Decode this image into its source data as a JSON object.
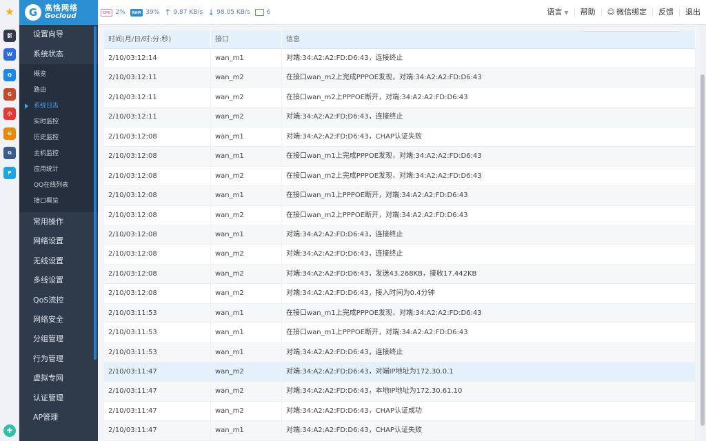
{
  "favorites": [
    {
      "name": "star",
      "color": "#f5b400",
      "label": "★"
    },
    {
      "name": "news",
      "color": "#333a48",
      "label": "新"
    },
    {
      "name": "doc",
      "color": "#2d6cdf",
      "label": "W"
    },
    {
      "name": "chat",
      "color": "#1e88e5",
      "label": "Q"
    },
    {
      "name": "game1",
      "color": "#c34a2c",
      "label": "G"
    },
    {
      "name": "red-app",
      "color": "#e53935",
      "label": "小"
    },
    {
      "name": "game2",
      "color": "#e8890c",
      "label": "G"
    },
    {
      "name": "game3",
      "color": "#3b5b8c",
      "label": "G"
    },
    {
      "name": "p-app",
      "color": "#1ca7e0",
      "label": "P"
    }
  ],
  "brand": {
    "name_cn": "高恪网络",
    "name_en": "Gocloud",
    "mark": "G"
  },
  "stats": {
    "cpu_chip": "CPU",
    "cpu": "2%",
    "ram_chip": "RAM",
    "ram": "39%",
    "upload": "9.87 KB/s",
    "download": "98.05 KB/s",
    "devices": "6"
  },
  "topmenu": {
    "language": "语言",
    "help": "帮助",
    "wechat": "微信绑定",
    "feedback": "反馈",
    "logout": "退出"
  },
  "sidebar": {
    "top": [
      "设置向导",
      "系统状态"
    ],
    "sub": [
      "概览",
      "路由",
      "系统日志",
      "实时监控",
      "历史监控",
      "主机监控",
      "应用统计",
      "QQ在线列表",
      "接口概览"
    ],
    "active_sub": 2,
    "nav": [
      "常用操作",
      "网络设置",
      "无线设置",
      "多线设置",
      "QoS流控",
      "网络安全",
      "分组管理",
      "行为管理",
      "虚拟专网",
      "认证管理",
      "AP管理"
    ]
  },
  "table": {
    "headers": [
      "时间(月/日/时:分:秒)",
      "接口",
      "信息"
    ],
    "rows": [
      [
        "2/10/03:12:14",
        "wan_m1",
        "对端:34:A2:A2:FD:D6:43，连接终止"
      ],
      [
        "2/10/03:12:11",
        "wan_m2",
        "在接口wan_m2上完成PPPOE发现，对端:34:A2:A2:FD:D6:43"
      ],
      [
        "2/10/03:12:11",
        "wan_m2",
        "在接口wan_m2上PPPOE断开，对端:34:A2:A2:FD:D6:43"
      ],
      [
        "2/10/03:12:11",
        "wan_m2",
        "对端:34:A2:A2:FD:D6:43，连接终止"
      ],
      [
        "2/10/03:12:08",
        "wan_m1",
        "对端:34:A2:A2:FD:D6:43，CHAP认证失败"
      ],
      [
        "2/10/03:12:08",
        "wan_m1",
        "在接口wan_m1上完成PPPOE发现，对端:34:A2:A2:FD:D6:43"
      ],
      [
        "2/10/03:12:08",
        "wan_m2",
        "在接口wan_m2上完成PPPOE发现，对端:34:A2:A2:FD:D6:43"
      ],
      [
        "2/10/03:12:08",
        "wan_m1",
        "在接口wan_m1上PPPOE断开，对端:34:A2:A2:FD:D6:43"
      ],
      [
        "2/10/03:12:08",
        "wan_m2",
        "在接口wan_m2上PPPOE断开，对端:34:A2:A2:FD:D6:43"
      ],
      [
        "2/10/03:12:08",
        "wan_m1",
        "对端:34:A2:A2:FD:D6:43，连接终止"
      ],
      [
        "2/10/03:12:08",
        "wan_m2",
        "对端:34:A2:A2:FD:D6:43，连接终止"
      ],
      [
        "2/10/03:12:08",
        "wan_m2",
        "对端:34:A2:A2:FD:D6:43，发送43.268KB，接收17.442KB"
      ],
      [
        "2/10/03:12:08",
        "wan_m2",
        "对端:34:A2:A2:FD:D6:43，接入时间为0.4分钟"
      ],
      [
        "2/10/03:11:53",
        "wan_m1",
        "在接口wan_m1上完成PPPOE发现，对端:34:A2:A2:FD:D6:43"
      ],
      [
        "2/10/03:11:53",
        "wan_m1",
        "在接口wan_m1上PPPOE断开，对端:34:A2:A2:FD:D6:43"
      ],
      [
        "2/10/03:11:53",
        "wan_m1",
        "对端:34:A2:A2:FD:D6:43，连接终止"
      ],
      [
        "2/10/03:11:47",
        "wan_m2",
        "对端:34:A2:A2:FD:D6:43，对端IP地址为172.30.0.1"
      ],
      [
        "2/10/03:11:47",
        "wan_m2",
        "对端:34:A2:A2:FD:D6:43，本地IP地址为172.30.61.10"
      ],
      [
        "2/10/03:11:47",
        "wan_m2",
        "对端:34:A2:A2:FD:D6:43，CHAP认证成功"
      ],
      [
        "2/10/03:11:47",
        "wan_m1",
        "对端:34:A2:A2:FD:D6:43，CHAP认证失败"
      ]
    ],
    "highlighted_row": 16
  },
  "colors": {
    "brand": "#2b8fd4",
    "sidebar": "#2f3a4b",
    "active": "#4aa3f0",
    "header_bg": "#e4f1fb"
  }
}
